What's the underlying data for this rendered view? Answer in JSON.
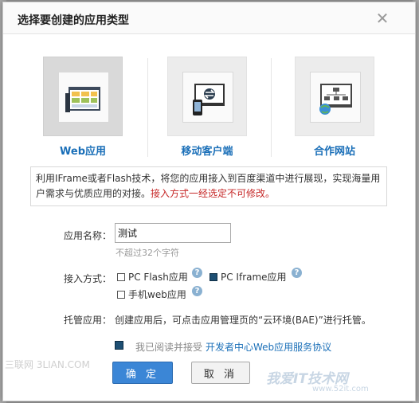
{
  "dialog": {
    "title": "选择要创建的应用类型",
    "close_glyph": "✕"
  },
  "app_types": [
    {
      "label": "Web应用",
      "icon": "web-app-icon",
      "selected": true
    },
    {
      "label": "移动客户端",
      "icon": "mobile-client-icon",
      "selected": false
    },
    {
      "label": "合作网站",
      "icon": "partner-site-icon",
      "selected": false
    }
  ],
  "description": {
    "text": "利用IFrame或者Flash技术，将您的应用接入到百度渠道中进行展现，实现海量用户需求与优质应用的对接。",
    "warning": "接入方式一经选定不可修改。"
  },
  "app_name": {
    "label": "应用名称：",
    "value": "测试",
    "hint": "不超过32个字符"
  },
  "access_method": {
    "label": "接入方式：",
    "options": [
      {
        "label": "PC Flash应用",
        "checked": false
      },
      {
        "label": "PC Iframe应用",
        "checked": true
      },
      {
        "label": "手机web应用",
        "checked": false
      }
    ],
    "help_glyph": "?"
  },
  "hosting": {
    "label": "托管应用：",
    "text": "创建应用后，可点击应用管理页的“云环境(BAE)”进行托管。"
  },
  "agreement": {
    "checked": true,
    "text": "我已阅读并接受",
    "link": "开发者中心Web应用服务协议"
  },
  "buttons": {
    "ok": "确 定",
    "cancel": "取 消"
  },
  "watermarks": {
    "left": "三联网 3LIAN.COM",
    "right_main": "我爱IT技术网",
    "right_sub": "www.52it.com"
  },
  "colors": {
    "accent": "#3b86d6",
    "link": "#1a6fb8",
    "warning": "#c62828"
  }
}
